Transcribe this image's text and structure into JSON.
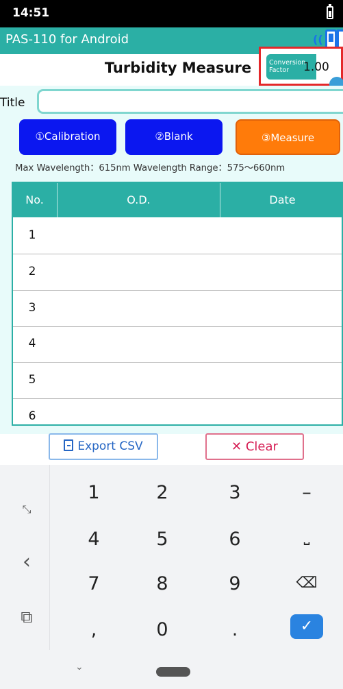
{
  "status_bar": {
    "time": "14:51"
  },
  "app_bar": {
    "title": "PAS-110 for Android",
    "bt_glyph": "(("
  },
  "header": {
    "title": "Turbidity Measure",
    "conversion_label": "Conversion Factor",
    "conversion_value": "1.00"
  },
  "form": {
    "title_label": "Title",
    "title_value": ""
  },
  "steps": {
    "calibration": "①Calibration",
    "blank": "②Blank",
    "measure": "③Measure"
  },
  "info_line": "Max Wavelength：615nm  Wavelength Range：575～660nm",
  "table": {
    "headers": [
      "No.",
      "O.D.",
      "Date"
    ],
    "rows": [
      {
        "no": "1",
        "od": "",
        "date": ""
      },
      {
        "no": "2",
        "od": "",
        "date": ""
      },
      {
        "no": "3",
        "od": "",
        "date": ""
      },
      {
        "no": "4",
        "od": "",
        "date": ""
      },
      {
        "no": "5",
        "od": "",
        "date": ""
      },
      {
        "no": "6",
        "od": "",
        "date": ""
      }
    ]
  },
  "actions": {
    "export": "Export CSV",
    "clear": "✕  Clear"
  },
  "keyboard": {
    "rows": [
      [
        "1",
        "2",
        "3",
        "–"
      ],
      [
        "4",
        "5",
        "6",
        "⎵"
      ],
      [
        "7",
        "8",
        "9",
        "⌫"
      ],
      [
        ",",
        "0",
        ".",
        "✓"
      ]
    ],
    "side_icons": [
      "⤡",
      "‹",
      "⧉"
    ]
  },
  "colors": {
    "teal": "#2bafa5",
    "blue_button": "#0b17f0",
    "orange_button": "#ff7b0a",
    "highlight_red": "#e4282a"
  }
}
